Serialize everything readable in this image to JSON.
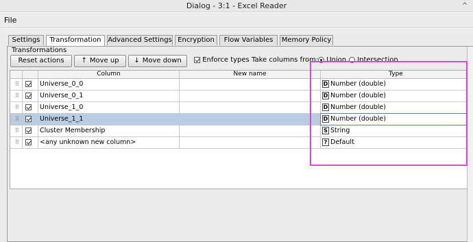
{
  "window": {
    "title": "Dialog - 3:1 - Excel Reader",
    "control_glyph": "^"
  },
  "menu": {
    "file": "File"
  },
  "tabs": [
    {
      "label": "Settings"
    },
    {
      "label": "Transformation"
    },
    {
      "label": "Advanced Settings"
    },
    {
      "label": "Encryption"
    },
    {
      "label": "Flow Variables"
    },
    {
      "label": "Memory Policy"
    }
  ],
  "active_tab": "Transformation",
  "panel": {
    "group_title": "Transformations",
    "reset_button": "Reset actions",
    "move_up_button": "Move up",
    "move_down_button": "Move down",
    "move_up_arrow": "↑",
    "move_down_arrow": "↓",
    "enforce_types_label": "Enforce types",
    "enforce_types_checked": true,
    "take_columns_label": "Take columns from:",
    "union_label": "Union",
    "intersection_label": "Intersection",
    "take_columns_selected": "Union"
  },
  "table": {
    "headers": {
      "column": "Column",
      "new_name": "New name",
      "type": "Type"
    },
    "grip_glyph": "⠿",
    "rows": [
      {
        "column": "Universe_0_0",
        "new_name": "",
        "type_icon": "D",
        "type": "Number (double)",
        "checked": true,
        "selected": false
      },
      {
        "column": "Universe_0_1",
        "new_name": "",
        "type_icon": "D",
        "type": "Number (double)",
        "checked": true,
        "selected": false
      },
      {
        "column": "Universe_1_0",
        "new_name": "",
        "type_icon": "D",
        "type": "Number (double)",
        "checked": true,
        "selected": false
      },
      {
        "column": "Universe_1_1",
        "new_name": "",
        "type_icon": "D",
        "type": "Number (double)",
        "checked": true,
        "selected": true
      },
      {
        "column": "Cluster Membership",
        "new_name": "",
        "type_icon": "S",
        "type": "String",
        "checked": true,
        "selected": false
      },
      {
        "column": "<any unknown new column>",
        "new_name": "",
        "type_icon": "?",
        "type": "Default",
        "checked": true,
        "selected": false
      }
    ]
  },
  "colors": {
    "selection": "#b8cde4",
    "annotation_box": "#e83ce0"
  }
}
